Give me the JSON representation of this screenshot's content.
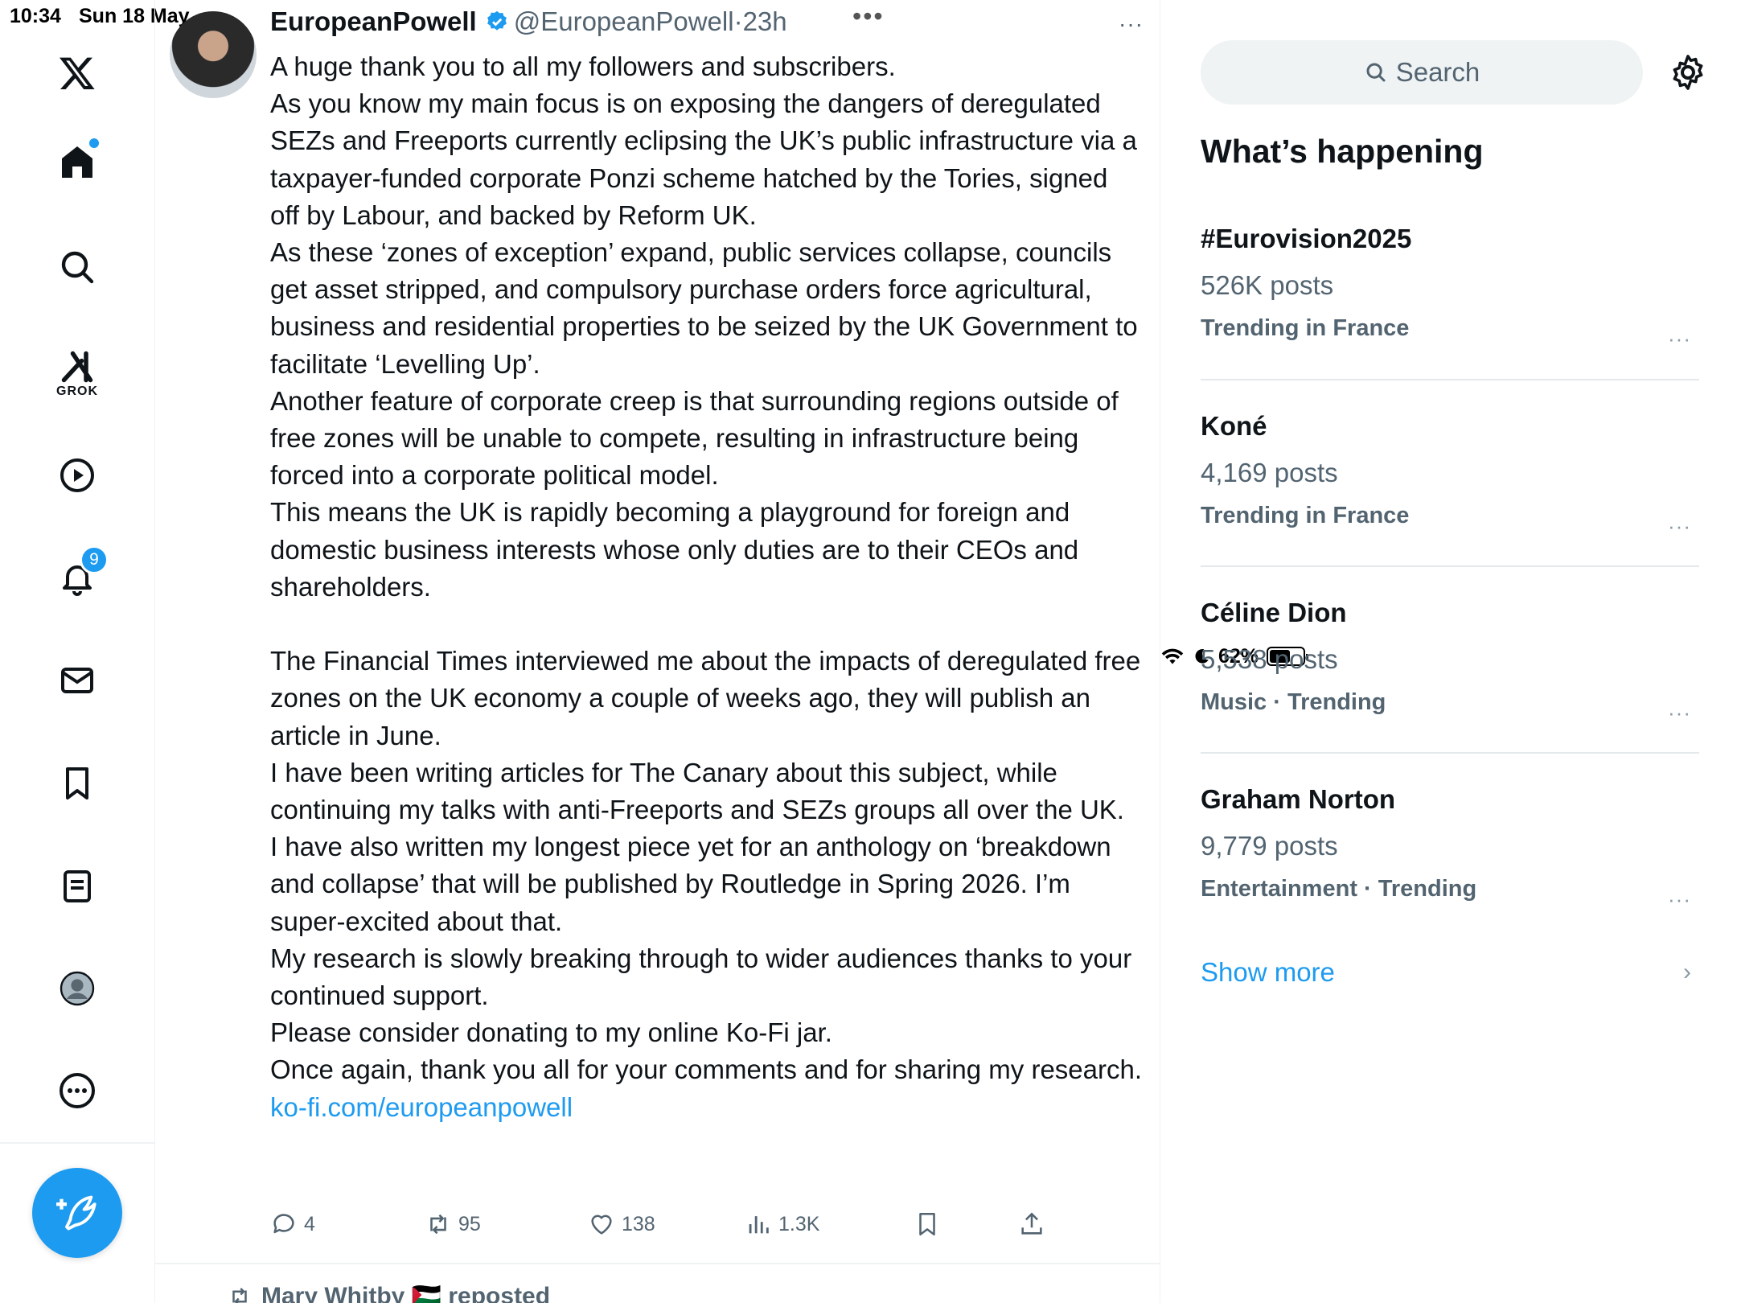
{
  "status_bar": {
    "time": "10:34",
    "date": "Sun 18 May",
    "battery": "62%",
    "battery_level": 0.62
  },
  "nav": {
    "notifications_badge": "9",
    "grok_label": "GROK"
  },
  "tweet": {
    "author_name": "EuropeanPowell",
    "handle": "@EuropeanPowell",
    "time": "23h",
    "more": "···",
    "body": [
      "A huge thank you to all my followers and subscribers.",
      "As you know my main focus is on exposing the dangers of deregulated SEZs and Freeports currently eclipsing the UK’s public infrastructure via a taxpayer-funded corporate Ponzi scheme hatched by the Tories, signed off by Labour, and backed by Reform UK.",
      "As these ‘zones of exception’ expand, public services collapse, councils get asset stripped, and compulsory purchase orders force agricultural, business and residential properties to be seized by the UK Government to facilitate ‘Levelling Up’.",
      "Another feature of corporate creep is that surrounding regions outside of free zones will be unable to compete, resulting in infrastructure being forced into a corporate political model.",
      "This means the UK is rapidly becoming a playground for foreign and domestic business interests whose only duties are to their CEOs and shareholders.",
      "",
      "The Financial Times interviewed me about the impacts of deregulated free zones on the UK economy a couple of weeks ago, they will publish an article in June.",
      "I have been writing articles for The Canary about this subject, while continuing my talks with anti-Freeports and SEZs groups all over the UK.",
      "I have also written my longest piece yet for an anthology on ‘breakdown and collapse’ that will be published by Routledge in Spring 2026. I’m super-excited about that.",
      "My research is slowly breaking through to wider audiences thanks to your continued support.",
      "Please consider donating to my online Ko-Fi jar.",
      "Once again, thank you all for your comments and for sharing my research."
    ],
    "link": "ko-fi.com/europeanpowell",
    "replies": "4",
    "reposts": "95",
    "likes": "138",
    "views": "1.3K"
  },
  "next_tweet": {
    "reposted_by": "Mary Whitby 🇵🇸 reposted"
  },
  "sidebar": {
    "search_placeholder": "Search",
    "title": "What’s happening",
    "trends": [
      {
        "name": "#Eurovision2025",
        "posts": "526K posts",
        "context": "Trending in France"
      },
      {
        "name": "Koné",
        "posts": "4,169 posts",
        "context": "Trending in France"
      },
      {
        "name": "Céline Dion",
        "posts": "5,538 posts",
        "context": "Music · Trending"
      },
      {
        "name": "Graham Norton",
        "posts": "9,779 posts",
        "context": "Entertainment · Trending"
      }
    ],
    "more_label": "···",
    "show_more": "Show more",
    "chevron": "›"
  },
  "colors": {
    "accent": "#1d9bf0",
    "text": "#0f1419",
    "muted": "#536471"
  }
}
